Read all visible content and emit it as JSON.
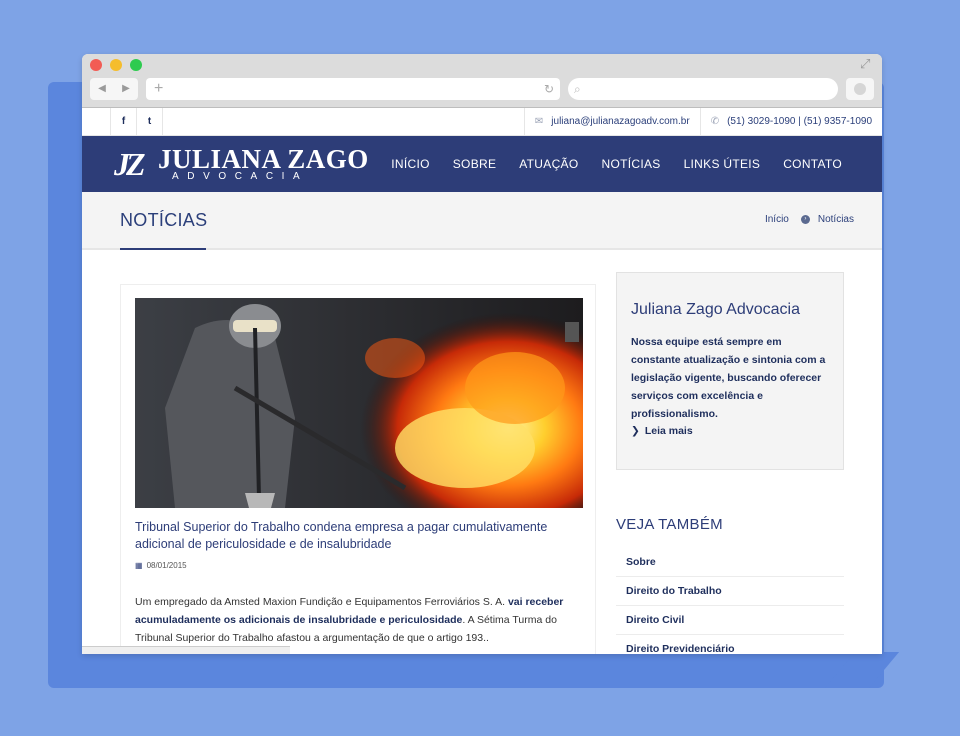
{
  "browser": {
    "nav_back": "◀",
    "nav_forward": "▶",
    "new_tab": "+",
    "reload": "↻",
    "search_icon": "⌕",
    "expand_icon": "⤢"
  },
  "topbar": {
    "social": [
      {
        "icon": "facebook-icon",
        "glyph": "f"
      },
      {
        "icon": "twitter-icon",
        "glyph": "t"
      }
    ],
    "email_icon": "✉",
    "email": "juliana@julianazagoadv.com.br",
    "phone_icon": "✆",
    "phone": "(51) 3029-1090 | (51) 9357-1090"
  },
  "header": {
    "logo_mark": "JZ",
    "logo_name": "JULIANA ZAGO",
    "logo_sub": "ADVOCACIA",
    "nav": [
      "INÍCIO",
      "SOBRE",
      "ATUAÇÃO",
      "NOTÍCIAS",
      "LINKS ÚTEIS",
      "CONTATO"
    ]
  },
  "titlebar": {
    "title": "NOTÍCIAS",
    "breadcrumb": {
      "home": "Início",
      "sep": "›",
      "current": "Notícias"
    }
  },
  "post": {
    "title": "Tribunal Superior do Trabalho condena empresa a pagar cumulativamente adicional de periculosidade e de insalubridade",
    "date_icon": "▦",
    "date": "08/01/2015",
    "body_1": "Um empregado da Amsted Maxion Fundição e Equipamentos Ferroviários S. A. ",
    "body_bold": "vai receber acumuladamente os adicionais de insalubridade e periculosidade",
    "body_2": ".  A Sétima Turma do Tribunal Superior do Trabalho afastou a argumentação de que o artigo 193.."
  },
  "sidebar": {
    "title": "Juliana Zago Advocacia",
    "text": "Nossa equipe está sempre em constante atualização e sintonia com a legislação vigente, buscando oferecer serviços com excelência e profissionalismo.",
    "read_more_icon": "❯",
    "read_more": "Leia mais",
    "veja_title": "VEJA TAMBÉM",
    "veja_items": [
      "Sobre",
      "Direito do Trabalho",
      "Direito Civil",
      "Direito Previdenciário"
    ]
  },
  "colors": {
    "page_bg": "#7ea3e6",
    "brand_navy": "#2d3d78",
    "title_bar_bg": "#f4f4f4"
  }
}
